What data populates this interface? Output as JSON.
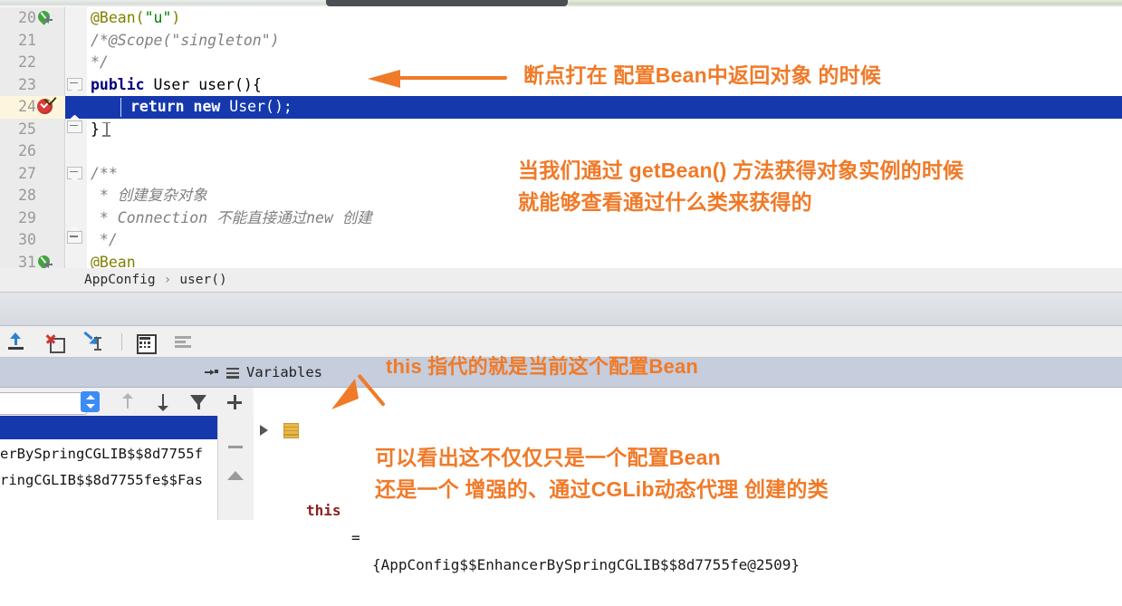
{
  "editor": {
    "lines": [
      {
        "no": "20",
        "indent": 0,
        "segments": [
          {
            "text": "@Bean(",
            "cls": "anno"
          },
          {
            "text": "\"u\"",
            "cls": "str"
          },
          {
            "text": ")",
            "cls": "anno"
          }
        ],
        "gutter": "bean-icon",
        "fold": null
      },
      {
        "no": "21",
        "indent": 0,
        "segments": [
          {
            "text": "/*@Scope(\"singleton\")",
            "cls": "cmt"
          }
        ],
        "gutter": null,
        "fold": null
      },
      {
        "no": "22",
        "indent": 0,
        "segments": [
          {
            "text": "*/",
            "cls": "cmt"
          }
        ],
        "gutter": null,
        "fold": null
      },
      {
        "no": "23",
        "indent": 0,
        "segments": [
          {
            "text": "public ",
            "cls": "kw"
          },
          {
            "text": "User user(){",
            "cls": ""
          }
        ],
        "gutter": null,
        "fold": "minus"
      },
      {
        "no": "24",
        "indent": 1,
        "segments": [
          {
            "text": "return new ",
            "cls": "kw-exec"
          },
          {
            "text": "User();",
            "cls": ""
          }
        ],
        "gutter": "breakpoint",
        "fold": null,
        "executing": true
      },
      {
        "no": "25",
        "indent": 0,
        "segments": [
          {
            "text": "}",
            "cls": ""
          }
        ],
        "gutter": null,
        "fold": "minus-up",
        "ibeam": true
      },
      {
        "no": "26",
        "indent": 0,
        "segments": [],
        "gutter": null,
        "fold": null
      },
      {
        "no": "27",
        "indent": 0,
        "segments": [
          {
            "text": "/**",
            "cls": "cmt-doc"
          }
        ],
        "gutter": null,
        "fold": "minus"
      },
      {
        "no": "28",
        "indent": 0,
        "segments": [
          {
            "text": " * 创建复杂对象",
            "cls": "cmt-doc"
          }
        ],
        "gutter": null,
        "fold": null
      },
      {
        "no": "29",
        "indent": 0,
        "segments": [
          {
            "text": " * Connection 不能直接通过new 创建",
            "cls": "cmt-doc"
          }
        ],
        "gutter": null,
        "fold": null
      },
      {
        "no": "30",
        "indent": 0,
        "segments": [
          {
            "text": " */",
            "cls": "cmt-doc"
          }
        ],
        "gutter": null,
        "fold": "minus-up"
      },
      {
        "no": "31",
        "indent": 0,
        "segments": [
          {
            "text": "@Bean",
            "cls": "anno"
          }
        ],
        "gutter": "bean-icon",
        "fold": null
      }
    ]
  },
  "breadcrumb": {
    "class_name": "AppConfig",
    "separator": "›",
    "method_name": "user()"
  },
  "debugger": {
    "toolbar": [
      {
        "name": "step-out-icon",
        "title": "Step Out"
      },
      {
        "name": "drop-frame-icon",
        "title": "Drop Frame"
      },
      {
        "name": "run-to-cursor-icon",
        "title": "Run to Cursor"
      },
      {
        "name": "evaluate-expression-icon",
        "title": "Evaluate Expression"
      },
      {
        "name": "sort-values-icon",
        "title": "Sort Values"
      }
    ],
    "variables_title": "Variables",
    "frames": {
      "search_value": "",
      "rows": [
        {
          "text": "",
          "selected": true
        },
        {
          "text": "erBySpringCGLIB$$8d7755f",
          "selected": false
        },
        {
          "text": "ringCGLIB$$8d7755fe$$Fas",
          "selected": false
        }
      ]
    },
    "variable_row": {
      "name": "this",
      "equals": "=",
      "value": "{AppConfig$$EnhancerBySpringCGLIB$$8d7755fe@2509}"
    }
  },
  "annotations": {
    "accent_color": "#f07a28",
    "note_breakpoint": "断点打在 配置Bean中返回对象 的时候",
    "note_getbean_line1": "当我们通过 getBean() 方法获得对象实例的时候",
    "note_getbean_line2": "就能够查看通过什么类来获得的",
    "note_this": "this 指代的就是当前这个配置Bean",
    "note_conclusion_line1": "可以看出这不仅仅只是一个配置Bean",
    "note_conclusion_line2": "还是一个 增强的、通过CGLib动态代理 创建的类"
  }
}
